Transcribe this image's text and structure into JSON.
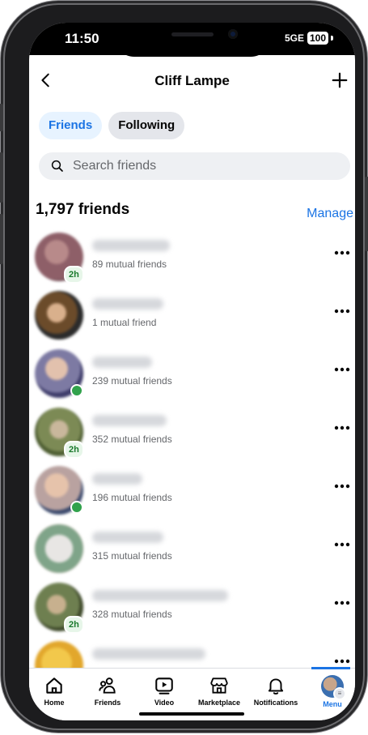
{
  "status": {
    "time": "11:50",
    "network": "5GE",
    "battery": "100"
  },
  "header": {
    "title": "Cliff Lampe",
    "back_icon": "chevron-left-icon",
    "add_icon": "plus-icon"
  },
  "tabs": [
    {
      "label": "Friends",
      "active": true
    },
    {
      "label": "Following",
      "active": false
    }
  ],
  "search": {
    "placeholder": "Search friends",
    "value": ""
  },
  "friends_count": "1,797 friends",
  "manage_label": "Manage",
  "friends": [
    {
      "mutual": "89 mutual friends",
      "badge": "2h",
      "online": false
    },
    {
      "mutual": "1 mutual friend",
      "badge": "",
      "online": false
    },
    {
      "mutual": "239 mutual friends",
      "badge": "",
      "online": true
    },
    {
      "mutual": "352 mutual friends",
      "badge": "2h",
      "online": false
    },
    {
      "mutual": "196 mutual friends",
      "badge": "",
      "online": true
    },
    {
      "mutual": "315 mutual friends",
      "badge": "",
      "online": false
    },
    {
      "mutual": "328 mutual friends",
      "badge": "2h",
      "online": false
    },
    {
      "mutual": "",
      "badge": "",
      "online": false
    }
  ],
  "bottom_nav": [
    {
      "label": "Home",
      "icon": "home-icon"
    },
    {
      "label": "Friends",
      "icon": "friends-icon"
    },
    {
      "label": "Video",
      "icon": "video-icon"
    },
    {
      "label": "Marketplace",
      "icon": "marketplace-icon"
    },
    {
      "label": "Notifications",
      "icon": "bell-icon"
    },
    {
      "label": "Menu",
      "icon": "profile-avatar-icon",
      "active": true
    }
  ],
  "colors": {
    "accent": "#1b74e4",
    "online": "#31a24c",
    "tab_active_bg": "#e7f3ff"
  }
}
